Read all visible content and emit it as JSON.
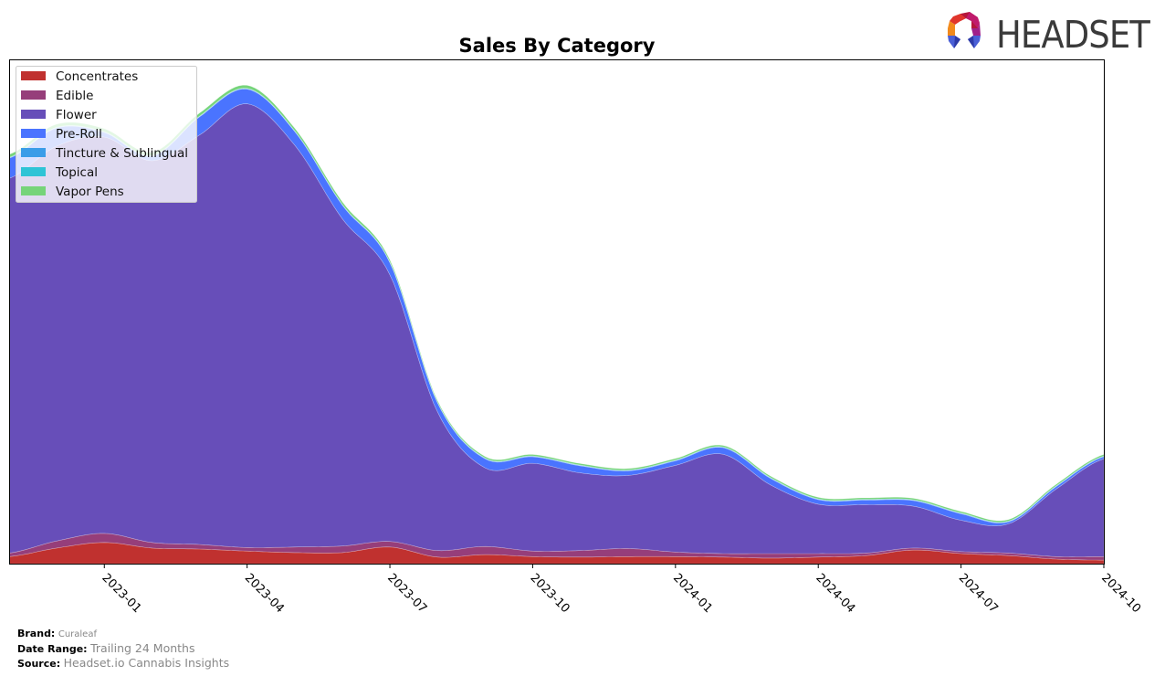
{
  "logo": {
    "text": "HEADSET"
  },
  "footer": {
    "brand_label": "Brand:",
    "brand_value": "Curaleaf",
    "date_range_label": "Date Range:",
    "date_range_value": "Trailing 24 Months",
    "source_label": "Source:",
    "source_value": "Headset.io Cannabis Insights"
  },
  "chart_data": {
    "type": "area",
    "stacked": true,
    "smooth": true,
    "title": "Sales By Category",
    "xlabel": "",
    "ylabel": "",
    "y_axis_visible": false,
    "grid": false,
    "legend_position": "top-left",
    "x": [
      "2022-11",
      "2022-12",
      "2023-01",
      "2023-02",
      "2023-03",
      "2023-04",
      "2023-05",
      "2023-06",
      "2023-07",
      "2023-08",
      "2023-09",
      "2023-10",
      "2023-11",
      "2023-12",
      "2024-01",
      "2024-02",
      "2024-03",
      "2024-04",
      "2024-05",
      "2024-06",
      "2024-07",
      "2024-08",
      "2024-09",
      "2024-10"
    ],
    "x_ticks": [
      "2023-01",
      "2023-04",
      "2023-07",
      "2023-10",
      "2024-01",
      "2024-04",
      "2024-07",
      "2024-10"
    ],
    "ylim": [
      0,
      100
    ],
    "series": [
      {
        "name": "Concentrates",
        "color": "#c0312f",
        "values": [
          1.4,
          3.1,
          4.2,
          3.1,
          2.9,
          2.5,
          2.2,
          2.2,
          3.3,
          1.3,
          1.8,
          1.4,
          1.3,
          1.4,
          1.4,
          1.3,
          1.1,
          1.3,
          1.6,
          2.7,
          2.0,
          1.6,
          0.9,
          0.7
        ]
      },
      {
        "name": "Edible",
        "color": "#963e7a",
        "values": [
          0.7,
          1.4,
          1.8,
          1.1,
          0.9,
          0.7,
          1.1,
          1.3,
          1.1,
          1.3,
          1.6,
          1.1,
          1.3,
          1.6,
          0.9,
          0.7,
          0.9,
          0.7,
          0.5,
          0.4,
          0.4,
          0.5,
          0.5,
          0.7
        ]
      },
      {
        "name": "Flower",
        "color": "#674eb9",
        "values": [
          74.3,
          78.3,
          78.6,
          75.7,
          81.2,
          88.0,
          79.7,
          64.9,
          52.9,
          27.5,
          15.6,
          17.4,
          15.4,
          14.5,
          17.2,
          19.7,
          13.6,
          9.8,
          9.6,
          8.3,
          6.2,
          5.8,
          13.4,
          19.4
        ]
      },
      {
        "name": "Pre-Roll",
        "color": "#4a74ff",
        "values": [
          4.0,
          3.6,
          0.9,
          0.9,
          3.6,
          2.9,
          2.7,
          2.7,
          2.4,
          1.8,
          1.8,
          1.3,
          1.4,
          0.9,
          0.9,
          1.3,
          1.3,
          0.9,
          0.9,
          1.1,
          1.3,
          0.4,
          0.5,
          0.4
        ]
      },
      {
        "name": "Tincture & Sublingual",
        "color": "#3a9de8",
        "values": [
          0.1,
          0.1,
          0.1,
          0.1,
          0.1,
          0.1,
          0.1,
          0.1,
          0.1,
          0.1,
          0.1,
          0.1,
          0.1,
          0.1,
          0.1,
          0.1,
          0.1,
          0.1,
          0.1,
          0.1,
          0.1,
          0.1,
          0.1,
          0.1
        ]
      },
      {
        "name": "Topical",
        "color": "#2ec4d6",
        "values": [
          0.05,
          0.05,
          0.05,
          0.05,
          0.05,
          0.05,
          0.05,
          0.05,
          0.05,
          0.05,
          0.05,
          0.05,
          0.05,
          0.05,
          0.05,
          0.05,
          0.05,
          0.05,
          0.05,
          0.05,
          0.05,
          0.05,
          0.05,
          0.05
        ]
      },
      {
        "name": "Vapor Pens",
        "color": "#76d47a",
        "values": [
          0.6,
          0.6,
          0.6,
          0.6,
          0.6,
          0.6,
          0.5,
          0.5,
          0.4,
          0.3,
          0.3,
          0.3,
          0.3,
          0.3,
          0.3,
          0.3,
          0.3,
          0.3,
          0.3,
          0.3,
          0.3,
          0.3,
          0.3,
          0.3
        ]
      }
    ]
  }
}
